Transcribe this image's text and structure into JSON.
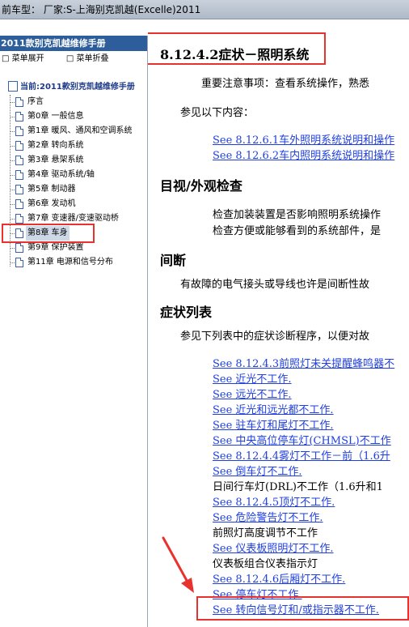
{
  "window": {
    "title": "前车型：  厂家:S-上海别克凯越(Excelle)2011"
  },
  "sidebar": {
    "header": "2011款别克凯越维修手册",
    "toolbar": {
      "expand": "菜单展开",
      "collapse": "菜单折叠"
    },
    "root": "当前:2011款别克凯越维修手册",
    "items": [
      {
        "label": "序言"
      },
      {
        "label": "第0章 一般信息"
      },
      {
        "label": "第1章 暖风、通风和空调系统"
      },
      {
        "label": "第2章 转向系统"
      },
      {
        "label": "第3章 悬架系统"
      },
      {
        "label": "第4章 驱动系统/轴"
      },
      {
        "label": "第5章 制动器"
      },
      {
        "label": "第6章 发动机"
      },
      {
        "label": "第7章 变速器/变速驱动桥"
      },
      {
        "label": "第8章 车身"
      },
      {
        "label": "第9章 保护装置"
      },
      {
        "label": "第11章 电源和信号分布"
      }
    ],
    "selected_index": 9
  },
  "content": {
    "title": "8.12.4.2症状－照明系统",
    "note": "重要注意事项：查看系统操作，熟悉",
    "see_following": "参见以下内容：",
    "links_top": [
      "See 8.12.6.1车外照明系统说明和操作",
      "See 8.12.6.2车内照明系统说明和操作"
    ],
    "visual": {
      "heading": "目视/外观检查",
      "line1": "检查加装装置是否影响照明系统操作",
      "line2": "检查方便或能够看到的系统部件，是"
    },
    "intermittent": {
      "heading": "间断",
      "text": "有故障的电气接头或导线也许是间断性故"
    },
    "symptoms": {
      "heading": "症状列表",
      "intro": "参见下列表中的症状诊断程序，以便对故"
    },
    "symptom_items": [
      {
        "text": "See 8.12.4.3前照灯未关提醒蜂鸣器不",
        "link": true
      },
      {
        "text": "See 近光不工作.",
        "link": true
      },
      {
        "text": "See 远光不工作.",
        "link": true
      },
      {
        "text": "See 近光和远光都不工作.",
        "link": true
      },
      {
        "text": "See 驻车灯和尾灯不工作.",
        "link": true
      },
      {
        "text": "See 中央高位停车灯(CHMSL)不工作",
        "link": true
      },
      {
        "text": "See 8.12.4.4雾灯不工作－前（1.6升",
        "link": true
      },
      {
        "text": "See 倒车灯不工作.",
        "link": true
      },
      {
        "text": "日间行车灯(DRL)不工作（1.6升和1",
        "link": false
      },
      {
        "text": "See 8.12.4.5顶灯不工作.",
        "link": true
      },
      {
        "text": "See 危险警告灯不工作.",
        "link": true
      },
      {
        "text": "前照灯高度调节不工作",
        "link": false
      },
      {
        "text": "See 仪表板照明灯不工作.",
        "link": true
      },
      {
        "text": "仪表板组合仪表指示灯",
        "link": false
      },
      {
        "text": "See 8.12.4.6后厢灯不工作.",
        "link": true
      },
      {
        "text": "See 停车灯不工作.",
        "link": true
      },
      {
        "text": "See 转向信号灯和/或指示器不工作.",
        "link": true
      }
    ]
  },
  "colors": {
    "link": "#1f3fe0",
    "highlight": "#e8322e",
    "sidebar_header": "#2d5d9a"
  }
}
